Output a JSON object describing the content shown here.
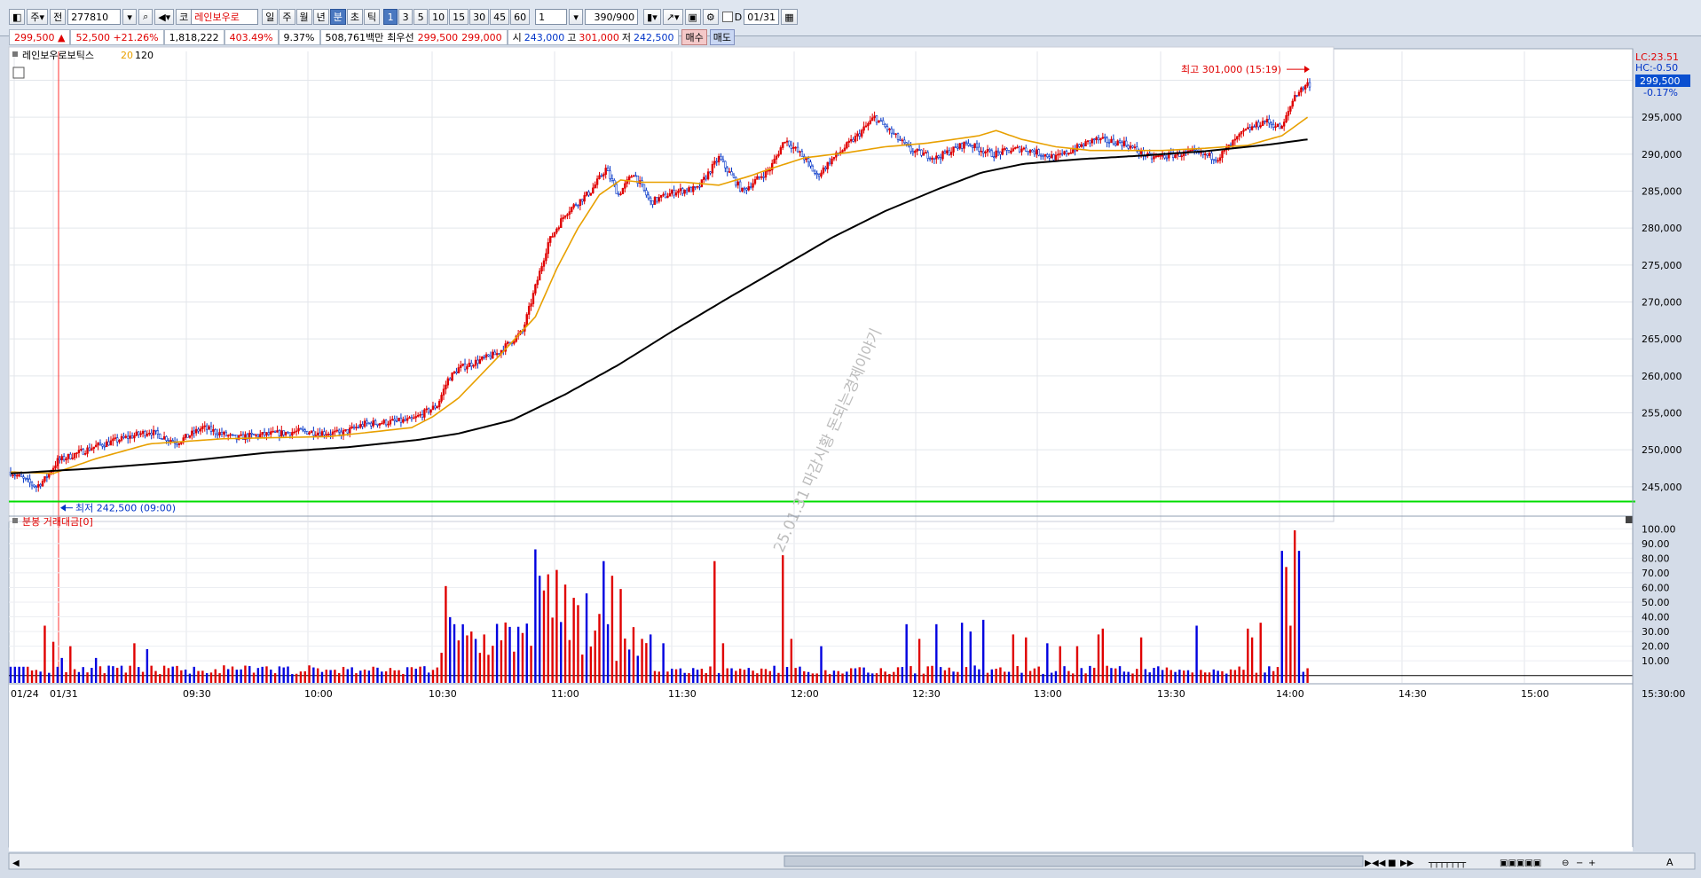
{
  "toolbar": {
    "market": "주",
    "scope": "전",
    "code": "277810",
    "name_tag": "코",
    "name": "레인보우로",
    "periods": [
      "일",
      "주",
      "월",
      "년",
      "분",
      "초",
      "틱"
    ],
    "active_period": "분",
    "intervals": [
      "1",
      "3",
      "5",
      "10",
      "15",
      "30",
      "45",
      "60"
    ],
    "active_interval": "1",
    "multiplier": "1",
    "count": "390/900",
    "d_label": "D",
    "date": "01/31"
  },
  "quote": {
    "price": "299,500 ▲",
    "change": "52,500 +21.26%",
    "volume": "1,818,222",
    "vol_ratio": "403.49%",
    "turnover": "9.37%",
    "amount": "508,761백만",
    "best_label": "최우선",
    "best_ask": "299,500",
    "best_bid": "299,000",
    "open_label": "시",
    "open": "243,000",
    "high_label": "고",
    "high": "301,000",
    "low_label": "저",
    "low": "242,500",
    "buy": "매수",
    "sell": "매도"
  },
  "chart_data": [
    {
      "type": "candlestick",
      "title": "레인보우로보틱스",
      "legend": [
        {
          "name": "20",
          "color": "#e8a000"
        },
        {
          "name": "120",
          "color": "#000000"
        }
      ],
      "y_ticks": [
        "300,000",
        "295,000",
        "290,000",
        "285,000",
        "280,000",
        "275,000",
        "270,000",
        "265,000",
        "260,000",
        "255,000",
        "250,000",
        "245,000"
      ],
      "ylim": [
        241500,
        303300
      ],
      "x_ticks": [
        "01/24",
        "01/31",
        "09:30",
        "10:00",
        "10:30",
        "11:00",
        "11:30",
        "12:00",
        "12:30",
        "13:00",
        "13:30",
        "14:00",
        "14:30",
        "15:00"
      ],
      "price_anchors": [
        [
          0,
          247000
        ],
        [
          12,
          245000
        ],
        [
          16,
          246000
        ],
        [
          22,
          248500
        ],
        [
          40,
          250500
        ],
        [
          65,
          252500
        ],
        [
          78,
          251000
        ],
        [
          90,
          253000
        ],
        [
          106,
          251500
        ],
        [
          110,
          251800
        ],
        [
          136,
          252500
        ],
        [
          155,
          252200
        ],
        [
          166,
          253500
        ],
        [
          188,
          254000
        ],
        [
          200,
          256000
        ],
        [
          205,
          259500
        ],
        [
          210,
          261000
        ],
        [
          228,
          263000
        ],
        [
          240,
          266000
        ],
        [
          246,
          272000
        ],
        [
          252,
          278000
        ],
        [
          260,
          282000
        ],
        [
          272,
          285000
        ],
        [
          279,
          288000
        ],
        [
          285,
          284500
        ],
        [
          292,
          287500
        ],
        [
          300,
          283500
        ],
        [
          312,
          285000
        ],
        [
          322,
          285300
        ],
        [
          332,
          289500
        ],
        [
          343,
          285000
        ],
        [
          356,
          288000
        ],
        [
          363,
          292000
        ],
        [
          372,
          289500
        ],
        [
          378,
          287000
        ],
        [
          384,
          289000
        ],
        [
          397,
          292500
        ],
        [
          405,
          295000
        ],
        [
          422,
          290500
        ],
        [
          434,
          289500
        ],
        [
          448,
          291500
        ],
        [
          460,
          290000
        ],
        [
          474,
          290800
        ],
        [
          490,
          289500
        ],
        [
          508,
          292000
        ],
        [
          522,
          291500
        ],
        [
          534,
          289500
        ],
        [
          554,
          290200
        ],
        [
          566,
          289500
        ],
        [
          578,
          293000
        ],
        [
          588,
          294500
        ],
        [
          596,
          293500
        ],
        [
          602,
          298000
        ],
        [
          608,
          299500
        ]
      ],
      "ma20_anchors": [
        [
          0,
          247000
        ],
        [
          20,
          246800
        ],
        [
          40,
          248800
        ],
        [
          65,
          250800
        ],
        [
          100,
          251500
        ],
        [
          150,
          251800
        ],
        [
          188,
          253000
        ],
        [
          198,
          254500
        ],
        [
          210,
          257000
        ],
        [
          230,
          263000
        ],
        [
          246,
          268000
        ],
        [
          256,
          274500
        ],
        [
          266,
          280000
        ],
        [
          276,
          284500
        ],
        [
          286,
          286500
        ],
        [
          296,
          286200
        ],
        [
          316,
          286200
        ],
        [
          332,
          285800
        ],
        [
          346,
          287000
        ],
        [
          356,
          288000
        ],
        [
          372,
          289500
        ],
        [
          392,
          290200
        ],
        [
          410,
          291000
        ],
        [
          430,
          291500
        ],
        [
          454,
          292500
        ],
        [
          462,
          293200
        ],
        [
          474,
          292000
        ],
        [
          490,
          291000
        ],
        [
          506,
          290500
        ],
        [
          522,
          290500
        ],
        [
          540,
          290500
        ],
        [
          560,
          290800
        ],
        [
          580,
          291200
        ],
        [
          596,
          292500
        ],
        [
          608,
          295000
        ]
      ],
      "ma120_anchors": [
        [
          0,
          246800
        ],
        [
          40,
          247500
        ],
        [
          80,
          248400
        ],
        [
          120,
          249600
        ],
        [
          160,
          250400
        ],
        [
          190,
          251300
        ],
        [
          210,
          252200
        ],
        [
          235,
          254000
        ],
        [
          260,
          257500
        ],
        [
          285,
          261500
        ],
        [
          310,
          266000
        ],
        [
          335,
          270300
        ],
        [
          360,
          274500
        ],
        [
          385,
          278700
        ],
        [
          410,
          282300
        ],
        [
          435,
          285300
        ],
        [
          455,
          287500
        ],
        [
          475,
          288700
        ],
        [
          500,
          289300
        ],
        [
          530,
          289800
        ],
        [
          560,
          290400
        ],
        [
          590,
          291300
        ],
        [
          608,
          292000
        ]
      ],
      "annotations": [
        {
          "text": "최고 301,000 (15:19)",
          "value": 301000,
          "color": "#e00000"
        },
        {
          "text": "최저 242,500 (09:00)",
          "value": 242500,
          "color": "#0034c8"
        }
      ],
      "reference_line": {
        "value": 243000,
        "color": "#00dd00"
      },
      "right_labels": {
        "lc": "LC:23.51",
        "hc": "HC:-0.50",
        "price": "299,500",
        "pct": "-0.17%"
      },
      "watermark": "25.01.31 마감시황 돈되는경제이야기"
    },
    {
      "type": "bar",
      "title": "분봉 거래대금[0]",
      "y_ticks": [
        "100.00",
        "90.00",
        "80.00",
        "70.00",
        "60.00",
        "50.00",
        "40.00",
        "30.00",
        "20.00",
        "10.00"
      ],
      "ylim": [
        -5,
        102
      ],
      "time_label": "15:30:00",
      "spikes": [
        [
          17,
          34
        ],
        [
          20,
          23
        ],
        [
          24,
          12
        ],
        [
          28,
          20
        ],
        [
          40,
          12
        ],
        [
          58,
          22
        ],
        [
          64,
          18
        ],
        [
          205,
          61
        ],
        [
          208,
          35
        ],
        [
          217,
          30
        ],
        [
          222,
          28
        ],
        [
          230,
          24
        ],
        [
          240,
          29
        ],
        [
          247,
          86
        ],
        [
          249,
          68
        ],
        [
          251,
          58
        ],
        [
          253,
          69
        ],
        [
          256,
          72
        ],
        [
          260,
          62
        ],
        [
          264,
          53
        ],
        [
          266,
          48
        ],
        [
          270,
          56
        ],
        [
          276,
          42
        ],
        [
          278,
          78
        ],
        [
          280,
          35
        ],
        [
          282,
          68
        ],
        [
          286,
          59
        ],
        [
          292,
          33
        ],
        [
          296,
          25
        ],
        [
          300,
          28
        ],
        [
          306,
          22
        ],
        [
          330,
          78
        ],
        [
          334,
          22
        ],
        [
          362,
          82
        ],
        [
          366,
          25
        ],
        [
          380,
          20
        ],
        [
          420,
          35
        ],
        [
          426,
          25
        ],
        [
          434,
          35
        ],
        [
          446,
          36
        ],
        [
          450,
          30
        ],
        [
          456,
          38
        ],
        [
          470,
          28
        ],
        [
          476,
          26
        ],
        [
          486,
          22
        ],
        [
          492,
          20
        ],
        [
          500,
          20
        ],
        [
          510,
          28
        ],
        [
          512,
          32
        ],
        [
          530,
          26
        ],
        [
          556,
          34
        ],
        [
          580,
          32
        ],
        [
          582,
          26
        ],
        [
          586,
          36
        ],
        [
          596,
          85
        ],
        [
          598,
          74
        ],
        [
          600,
          34
        ],
        [
          602,
          99
        ],
        [
          604,
          85
        ]
      ]
    }
  ],
  "footer": {
    "sec": "초",
    "ctrl": "A"
  }
}
